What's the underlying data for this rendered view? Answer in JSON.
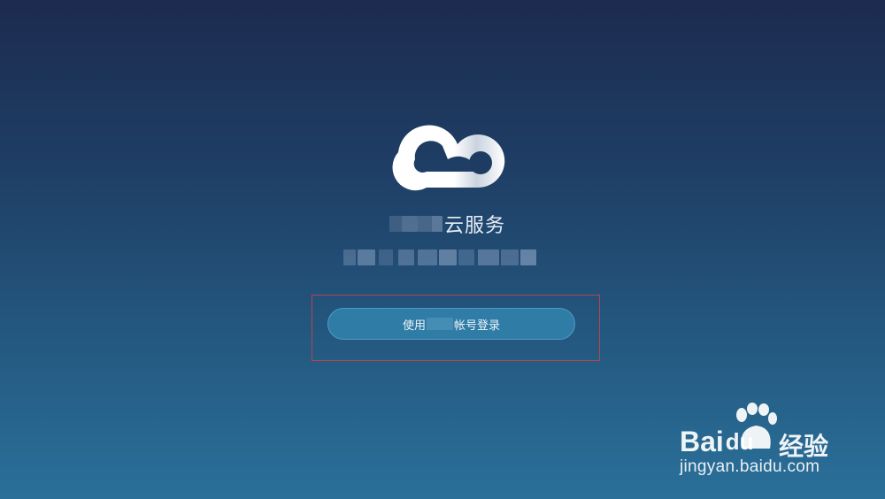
{
  "app": {
    "logo_icon": "cloud-icon",
    "service_title": "云服务",
    "background_top": "#1c2b4f",
    "background_bottom": "#2a7099"
  },
  "login": {
    "button_label_prefix": "使用",
    "button_label_suffix": "帐号登录",
    "button_color": "#2f7ca6"
  },
  "annotation": {
    "highlight_color": "#b5454e"
  },
  "watermark": {
    "brand_text_1": "Bai",
    "brand_text_2": "du",
    "brand_cn": "经验",
    "url": "jingyan.baidu.com",
    "icon": "paw-icon"
  }
}
